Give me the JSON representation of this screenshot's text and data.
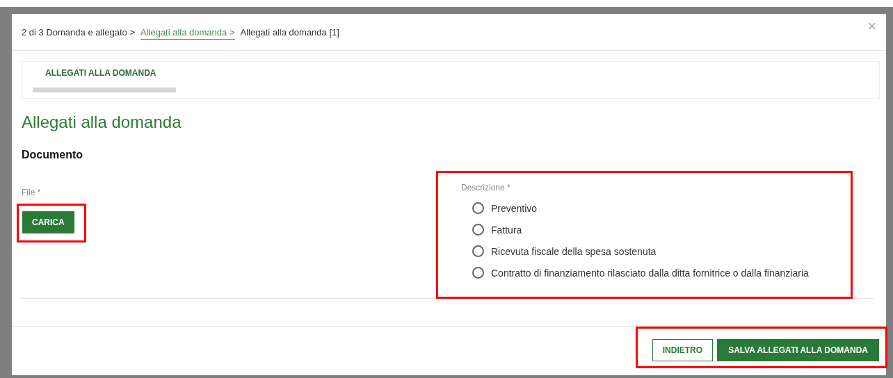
{
  "breadcrumb": [
    {
      "label": "2 di 3 Domanda e allegato",
      "kind": "text",
      "separator": ">"
    },
    {
      "label": "Allegati alla domanda",
      "kind": "link",
      "separator": ">"
    },
    {
      "label": "Allegati alla domanda [1]",
      "kind": "current"
    }
  ],
  "close": "×",
  "tabs": [
    {
      "label": "ALLEGATI ALLA DOMANDA",
      "selected": true
    }
  ],
  "heading": "Allegati alla domanda",
  "section": "Documento",
  "file": {
    "label": "File *",
    "button": "CARICA"
  },
  "description": {
    "label": "Descrizione *",
    "options": [
      {
        "label": "Preventivo",
        "selected": false
      },
      {
        "label": "Fattura",
        "selected": false
      },
      {
        "label": "Ricevuta fiscale della spesa sostenuta",
        "selected": false
      },
      {
        "label": "Contratto di finanziamento rilasciato dalla ditta fornitrice o dalla finanziaria",
        "selected": false
      }
    ]
  },
  "buttons": [
    {
      "label": "INDIETRO",
      "kind": "secondary"
    },
    {
      "label": "SALVA ALLEGATI ALLA DOMANDA",
      "kind": "primary"
    }
  ]
}
